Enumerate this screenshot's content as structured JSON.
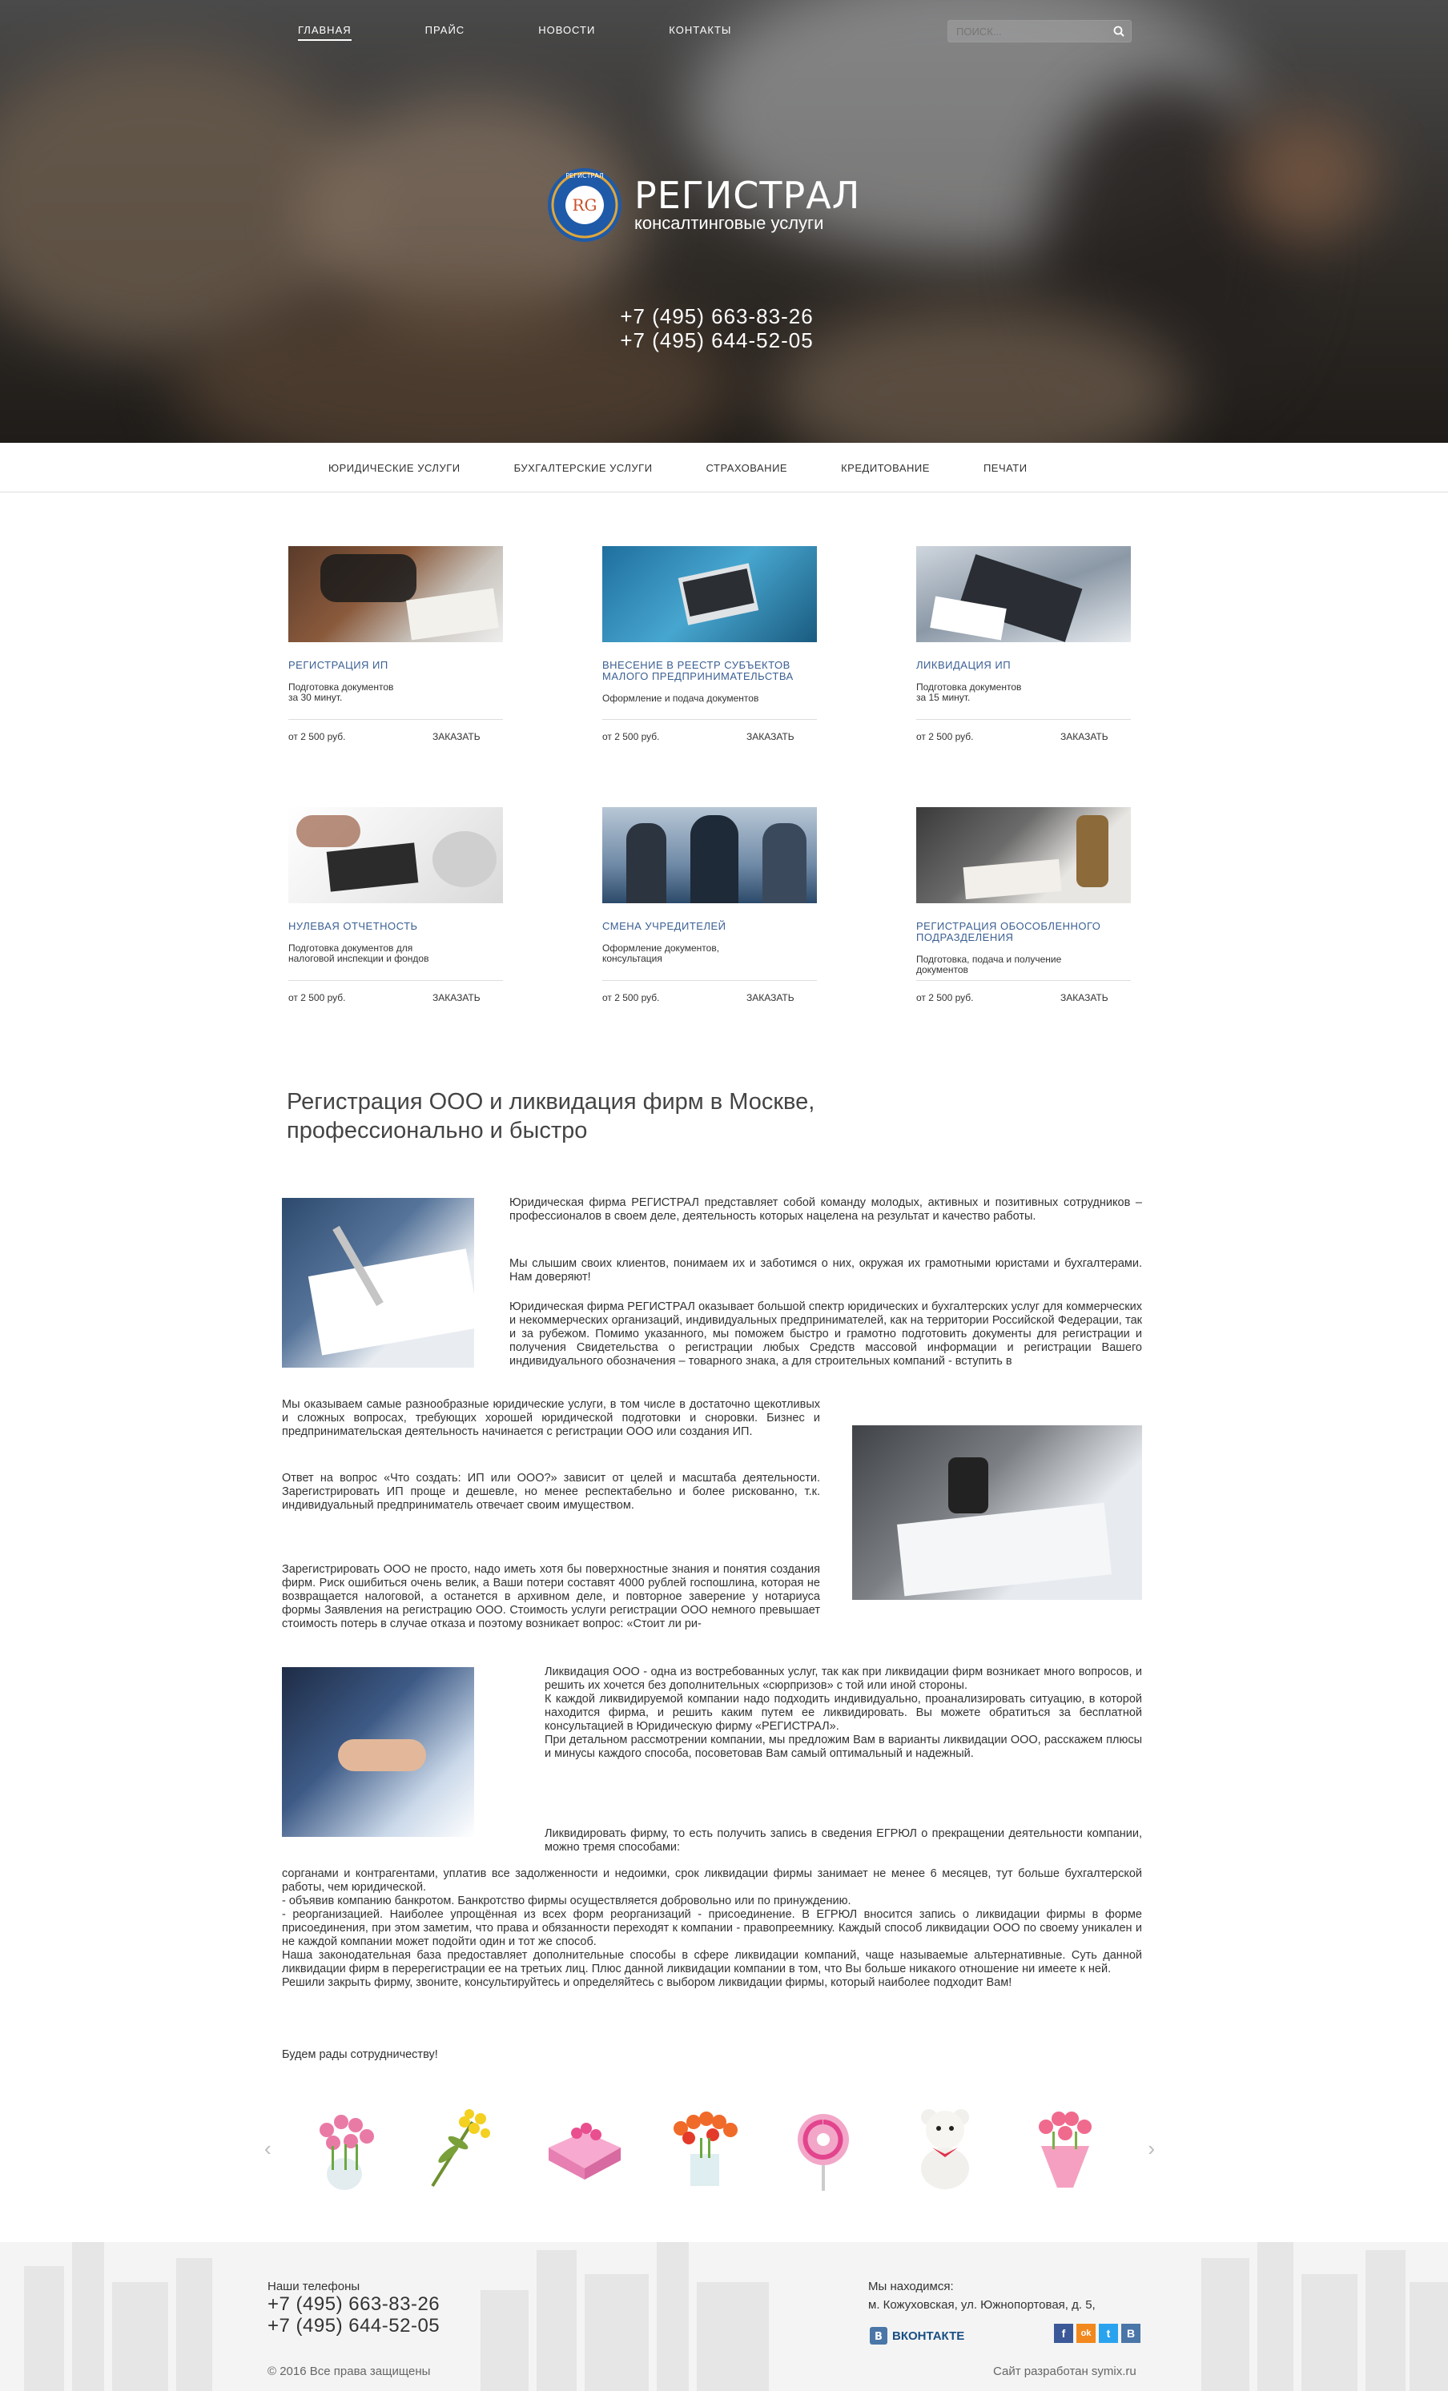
{
  "nav": {
    "items": [
      "ГЛАВНАЯ",
      "ПРАЙС",
      "НОВОСТИ",
      "КОНТАКТЫ"
    ],
    "search_placeholder": "ПОИСК..."
  },
  "brand": {
    "name": "РЕГИСТРАЛ",
    "tagline": "консалтинговые услуги",
    "seal_text": "РЕГИСТРАЛ"
  },
  "hero_phones": [
    "+7 (495) 663-83-26",
    "+7 (495) 644-52-05"
  ],
  "subnav": [
    "ЮРИДИЧЕСКИЕ УСЛУГИ",
    "БУХГАЛТЕРСКИЕ УСЛУГИ",
    "СТРАХОВАНИЕ",
    "КРЕДИТОВАНИЕ",
    "ПЕЧАТИ"
  ],
  "cards": [
    {
      "title": "Регистрация ИП",
      "desc": "Подготовка документов\nза 30 минут.",
      "price": "от 2 500 руб.",
      "order": "ЗАКАЗАТЬ"
    },
    {
      "title": "Внесение в реестр субъектов малого предпринимательства",
      "desc": "Оформление и подача документов",
      "price": "от 2 500 руб.",
      "order": "ЗАКАЗАТЬ"
    },
    {
      "title": "Ликвидация ИП",
      "desc": "Подготовка документов\nза 15 минут.",
      "price": "от 2 500 руб.",
      "order": "ЗАКАЗАТЬ"
    },
    {
      "title": "Нулевая отчетность",
      "desc": "Подготовка документов для\nналоговой инспекции и фондов",
      "price": "от 2 500 руб.",
      "order": "ЗАКАЗАТЬ"
    },
    {
      "title": "Смена учредителей",
      "desc": "Оформление документов,\nконсультация",
      "price": "от 2 500 руб.",
      "order": "ЗАКАЗАТЬ"
    },
    {
      "title": "Регистрация обособленного подразделения",
      "desc": "Подготовка, подача и получение\nдокументов",
      "price": "от 2 500 руб.",
      "order": "ЗАКАЗАТЬ"
    }
  ],
  "article": {
    "heading": "Регистрация ООО и ликвидация фирм в Москве, профессионально и быстро",
    "p1": "Юридическая фирма РЕГИСТРАЛ представляет собой команду молодых, активных и позитивных сотрудников – профессионалов в своем деле, деятельность которых нацелена на результат и качество работы.",
    "p2": "Мы слышим своих клиентов, понимаем их и заботимся о них, окружая их грамотными юристами и бухгалтерами. Нам доверяют!",
    "p3": "Юридическая фирма РЕГИСТРАЛ оказывает большой спектр юридических и бухгалтерских услуг для коммерческих и некоммерческих организаций, индивидуальных предпринимателей, как на территории Российской Федерации, так и за рубежом. Помимо указанного, мы поможем быстро и грамотно подготовить документы для регистрации и получения Свидетельства о регистрации любых Средств массовой информации и регистрации Вашего индивидуального обозначения – товарного знака, а для строительных компаний - вступить в",
    "p4": "Мы оказываем самые разнообразные юридические услуги, в том числе в достаточно щекотливых и сложных вопросах, требующих хорошей юридической подготовки и сноровки. Бизнес и предпринимательская деятельность начинается с регистрации ООО или создания ИП.",
    "p5": "Ответ на вопрос «Что создать: ИП или ООО?» зависит от целей и масштаба деятельности. Зарегистрировать ИП проще и дешевле, но менее респектабельно и более рискованно, т.к. индивидуальный предприниматель отвечает своим имуществом.",
    "p6": "Зарегистрировать ООО не просто, надо иметь хотя бы поверхностные знания и понятия создания фирм. Риск ошибиться очень велик, а Ваши потери составят 4000 рублей госпошлина, которая не возвращается налоговой, а останется в архивном деле, и повторное заверение у нотариуса формы Заявления на регистрацию ООО. Стоимость услуги регистрации ООО немного превышает стоимость потерь в случае отказа и поэтому возникает вопрос: «Стоит ли ри-",
    "p7": "Ликвидация ООО - одна из востребованных услуг, так как при ликвидации фирм возникает много вопросов, и решить их хочется без дополнительных «сюрпризов» с той или иной стороны.\nК каждой ликвидируемой компании надо подходить индивидуально, проанализировать ситуацию, в которой находится фирма, и решить каким путем ее ликвидировать. Вы можете обратиться за бесплатной консультацией в Юридическую фирму «РЕГИСТРАЛ».\nПри детальном рассмотрении компании, мы предложим Вам в варианты ликвидации ООО, расскажем плюсы и минусы каждого способа, посоветовав Вам самый оптимальный и надежный.",
    "p8": "Ликвидировать фирму, то есть получить запись в сведения ЕГРЮЛ о прекращении деятельности компании, можно тремя способами:",
    "p9": "сорганами и контрагентами, уплатив все задолженности и недоимки, срок ликвидации фирмы занимает не менее 6 месяцев, тут больше бухгалтерской работы, чем юридической.\n- объявив компанию банкротом. Банкротство фирмы осуществляется добровольно или по принуждению.\n- реорганизацией. Наиболее упрощённая из всех форм реорганизаций - присоединение. В ЕГРЮЛ вносится запись о ликвидации фирмы в форме присоединения, при этом заметим, что права и обязанности переходят к компании - правопреемнику. Каждый способ ликвидации ООО по своему уникален и не каждой компании может подойти один и тот же способ.\nНаша законодательная база предоставляет дополнительные способы в сфере ликвидации компаний, чаще называемые альтернативные. Суть данной ликвидации фирм в перерегистрации ее на третьих лиц. Плюс данной ликвидации компании в том, что Вы больше никакого отношение ни имеете к ней.\nРешили закрыть фирму, звоните, консультируйтесь и определяйтесь с выбором ликвидации фирмы, который наиболее подходит Вам!",
    "p10": "Будем рады сотрудничеству!"
  },
  "carousel": {
    "prev": "‹",
    "next": "›",
    "items": [
      "tulips-vase",
      "mimosa",
      "gift-box-pink",
      "orange-tulips",
      "lollipop",
      "teddy-bear",
      "tulip-bouquet"
    ]
  },
  "footer": {
    "phones_label": "Наши телефоны",
    "phones": [
      "+7 (495) 663-83-26",
      "+7 (495) 644-52-05"
    ],
    "location_label": "Мы находимся:",
    "address": "м. Кожуховская, ул. Южнопортовая, д. 5,",
    "vk_label": "ВКОНТАКТЕ",
    "social": [
      "f",
      "ok",
      "t",
      "B"
    ],
    "copyright": "© 2016 Все права защищены",
    "developer": "Сайт разработан symix.ru"
  },
  "colors": {
    "accent": "#3a5f93",
    "vk": "#1a4f84"
  }
}
